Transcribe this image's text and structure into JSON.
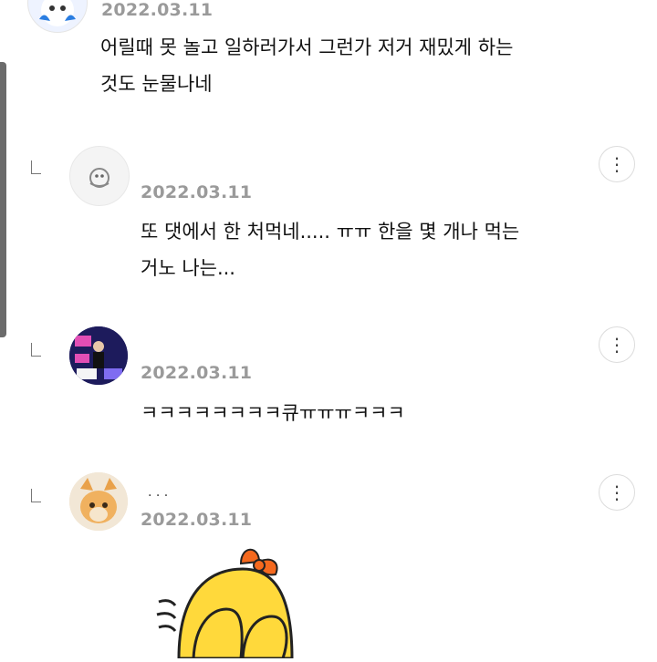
{
  "scrollbar": "visible",
  "comments": [
    {
      "type": "comment",
      "date": "2022.03.11",
      "text": "어릴때 못 놀고 일하러가서 그런가 저거 재밌게 하는\n것도 눈물나네",
      "avatar_icon": "character-avatar-icon"
    },
    {
      "type": "reply",
      "date": "2022.03.11",
      "text": "또 댓에서 한 처먹네..... ㅠㅠ 한을 몇 개나 먹는\n거노 나는...",
      "avatar_icon": "default-avatar-icon",
      "more_icon": "more-vertical-icon"
    },
    {
      "type": "reply",
      "date": "2022.03.11",
      "text": "ㅋㅋㅋㅋㅋㅋㅋㅋ큐ㅠㅠㅠㅋㅋㅋ",
      "avatar_icon": "tv-show-avatar-icon",
      "more_icon": "more-vertical-icon"
    },
    {
      "type": "reply",
      "date": "2022.03.11",
      "name_partial": "· · ·",
      "avatar_icon": "cat-avatar-icon",
      "sticker_icon": "yellow-chick-sticker-icon",
      "more_icon": "more-vertical-icon"
    }
  ],
  "colors": {
    "date": "#9a9a9a",
    "text": "#111111",
    "border": "#dcdcdc",
    "sticker_yellow": "#ffd93b",
    "sticker_orange": "#f5691e"
  }
}
